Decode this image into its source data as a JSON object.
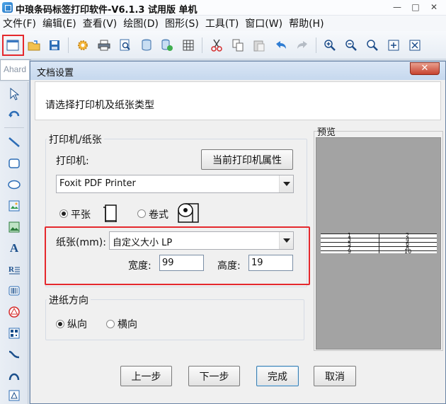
{
  "app": {
    "title": "中琅条码标签打印软件-V6.1.3 试用版 单机",
    "window_controls": [
      "—",
      "□",
      "✕"
    ]
  },
  "menubar": {
    "items": [
      "文件(F)",
      "编辑(E)",
      "查看(V)",
      "绘图(D)",
      "图形(S)",
      "工具(T)",
      "窗口(W)",
      "帮助(H)"
    ]
  },
  "toolbar": {
    "icons": [
      "new-document-icon",
      "open-folder-icon",
      "save-icon",
      "settings-gear-icon",
      "print-icon",
      "print-preview-icon",
      "database-icon",
      "database-settings-icon",
      "grid-icon",
      "cut-icon",
      "copy-icon",
      "paste-icon",
      "undo-icon",
      "redo-icon",
      "zoom-in-icon",
      "zoom-out-icon",
      "zoom-fit-icon",
      "fit-page-icon",
      "actual-size-icon"
    ],
    "font_name": "Ahard"
  },
  "left_toolbox": {
    "icons": [
      "select-arrow-icon",
      "rotate-tool-icon",
      "line-tool-icon",
      "rectangle-tool-icon",
      "ellipse-tool-icon",
      "image-tool-icon",
      "picture-tool-icon",
      "text-tool-icon",
      "rich-text-tool-icon",
      "barcode-tool-icon",
      "polygon-tool-icon",
      "qrcode-tool-icon",
      "curve-tool-icon",
      "arc-tool-icon",
      "shape-tool-icon"
    ]
  },
  "dialog": {
    "title": "文档设置",
    "close_label": "✕",
    "header_text": "请选择打印机及纸张类型",
    "printer_group_label": "打印机/纸张",
    "printer_label": "打印机:",
    "printer_properties_button": "当前打印机属性",
    "printer_value": "Foxit PDF Printer",
    "paper_flat_label": "平张",
    "paper_roll_label": "卷式",
    "paper_type": "flat",
    "paper_label": "纸张(mm):",
    "paper_value": "自定义大小 LP",
    "width_label": "宽度:",
    "width_value": "99",
    "height_label": "高度:",
    "height_value": "19",
    "feed_group_label": "进纸方向",
    "feed_portrait_label": "纵向",
    "feed_landscape_label": "横向",
    "feed_direction": "portrait",
    "preview_label": "预览",
    "preview_numbers": [
      "1",
      "2",
      "3",
      "4",
      "5",
      "6",
      "7",
      "8",
      "9",
      "10"
    ],
    "buttons": {
      "prev": "上一步",
      "next": "下一步",
      "finish": "完成",
      "cancel": "取消"
    }
  },
  "colors": {
    "highlight_red": "#e5282d",
    "preview_gray": "#a3a3a3",
    "dialog_bg": "#f0f0f0"
  }
}
